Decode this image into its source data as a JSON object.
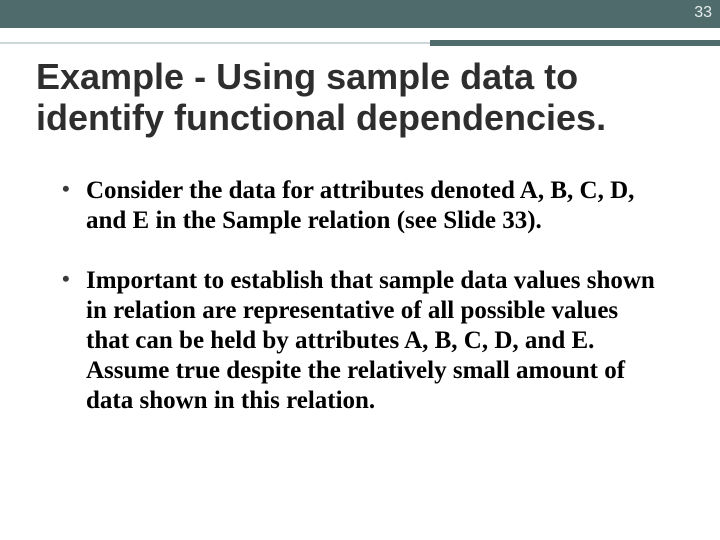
{
  "page_number": "33",
  "title": "Example - Using sample data to identify functional dependencies.",
  "bullets": [
    "Consider the data for attributes denoted A, B, C, D, and E in the Sample relation (see Slide 33).",
    "Important to establish that sample data values shown in relation are representative of all possible values that can be held by attributes A, B, C, D, and E. Assume true despite the relatively small amount of data shown in this relation."
  ]
}
